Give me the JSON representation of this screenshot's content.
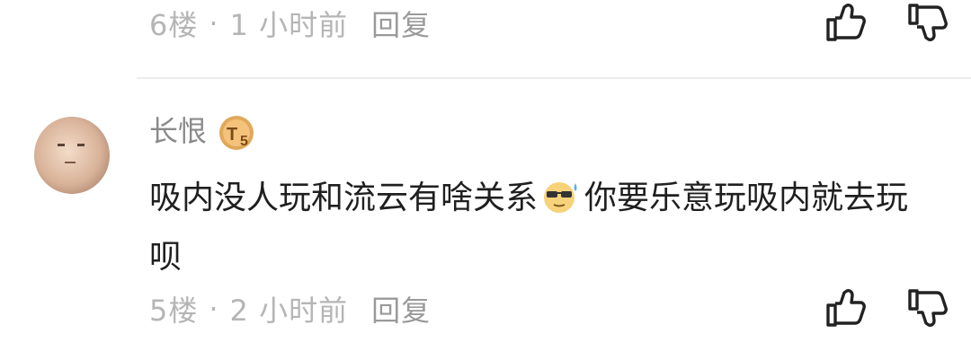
{
  "prev_comment": {
    "floor": "6楼",
    "separator": "·",
    "time": "1 小时前",
    "reply_label": "回复"
  },
  "comment": {
    "username": "长恨",
    "level_badge": "T5",
    "text_part1": "吸内没人玩和流云有啥关系",
    "emoji": "sweat-sunglasses-emoji",
    "text_part2": "你要乐意玩吸内就去玩呗",
    "floor": "5楼",
    "separator": "·",
    "time": "2 小时前",
    "reply_label": "回复"
  },
  "icons": {
    "like": "thumbs-up-icon",
    "dislike": "thumbs-down-icon"
  },
  "colors": {
    "meta_text": "#b5b5b5",
    "comment_text": "#1f1f1f",
    "username": "#8a8a8a",
    "badge": "#d9a24a"
  }
}
